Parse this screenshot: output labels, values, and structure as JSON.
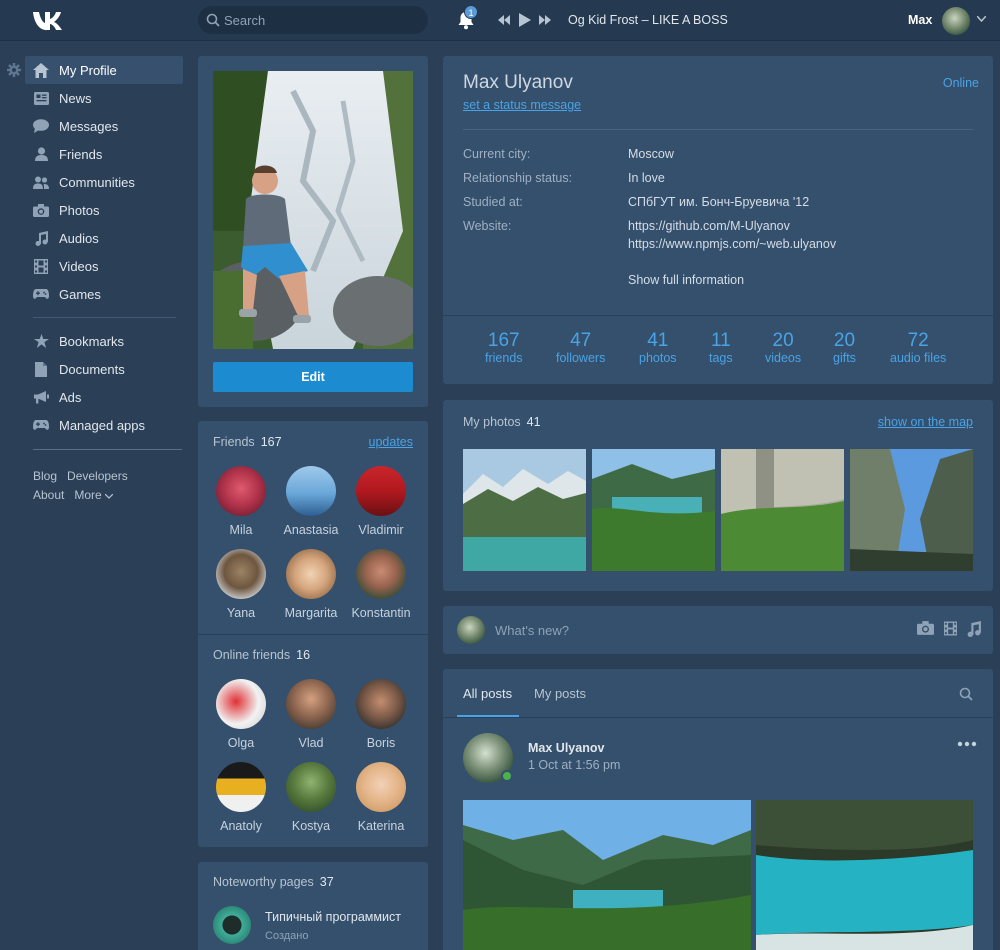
{
  "header": {
    "search_placeholder": "Search",
    "notifications_count": "1",
    "track": "Og Kid Frost – LIKE A BOSS",
    "user_name": "Max"
  },
  "sidebar": {
    "items": [
      {
        "label": "My Profile",
        "icon": "home-icon"
      },
      {
        "label": "News",
        "icon": "news-icon"
      },
      {
        "label": "Messages",
        "icon": "messages-icon"
      },
      {
        "label": "Friends",
        "icon": "friends-icon"
      },
      {
        "label": "Communities",
        "icon": "communities-icon"
      },
      {
        "label": "Photos",
        "icon": "camera-icon"
      },
      {
        "label": "Audios",
        "icon": "music-note-icon"
      },
      {
        "label": "Videos",
        "icon": "film-icon"
      },
      {
        "label": "Games",
        "icon": "gamepad-icon"
      }
    ],
    "items2": [
      {
        "label": "Bookmarks",
        "icon": "star-icon"
      },
      {
        "label": "Documents",
        "icon": "document-icon"
      },
      {
        "label": "Ads",
        "icon": "megaphone-icon"
      },
      {
        "label": "Managed apps",
        "icon": "gamepad-icon"
      }
    ],
    "footer": [
      "Blog",
      "Developers",
      "About",
      "More"
    ]
  },
  "profile": {
    "edit_label": "Edit",
    "name": "Max Ulyanov",
    "status_link": "set a status message",
    "online": "Online",
    "info": [
      {
        "key": "Current city:",
        "value": "Moscow"
      },
      {
        "key": "Relationship status:",
        "value": "In love"
      },
      {
        "key": "Studied at:",
        "value": "СПбГУТ им. Бонч-Бруевича '12"
      },
      {
        "key": "Website:",
        "value": "https://github.com/M-Ulyanov"
      },
      {
        "key": "",
        "value": "https://www.npmjs.com/~web.ulyanov"
      }
    ],
    "show_full": "Show full information",
    "counters": [
      {
        "n": "167",
        "l": "friends"
      },
      {
        "n": "47",
        "l": "followers"
      },
      {
        "n": "41",
        "l": "photos"
      },
      {
        "n": "11",
        "l": "tags"
      },
      {
        "n": "20",
        "l": "videos"
      },
      {
        "n": "20",
        "l": "gifts"
      },
      {
        "n": "72",
        "l": "audio files"
      }
    ]
  },
  "friends": {
    "title": "Friends",
    "count": "167",
    "updates": "updates",
    "list": [
      "Mila",
      "Anastasia",
      "Vladimir",
      "Yana",
      "Margarita",
      "Konstantin"
    ]
  },
  "online_friends": {
    "title": "Online friends",
    "count": "16",
    "list": [
      "Olga",
      "Vlad",
      "Boris",
      "Anatoly",
      "Kostya",
      "Katerina"
    ]
  },
  "noteworthy": {
    "title": "Noteworthy pages",
    "count": "37",
    "item_name": "Типичный программист",
    "item_sub": "Создано"
  },
  "photos": {
    "title": "My photos",
    "count": "41",
    "map_link": "show on the map"
  },
  "whats_new": {
    "placeholder": "What's new?"
  },
  "posts": {
    "tab_all": "All posts",
    "tab_mine": "My posts",
    "author": "Max Ulyanov",
    "date": "1 Oct at 1:56 pm"
  },
  "colors": {
    "background": "#2b3f56",
    "panel": "#34506c",
    "accent": "#4aa3e6",
    "button": "#1c8bd0"
  }
}
